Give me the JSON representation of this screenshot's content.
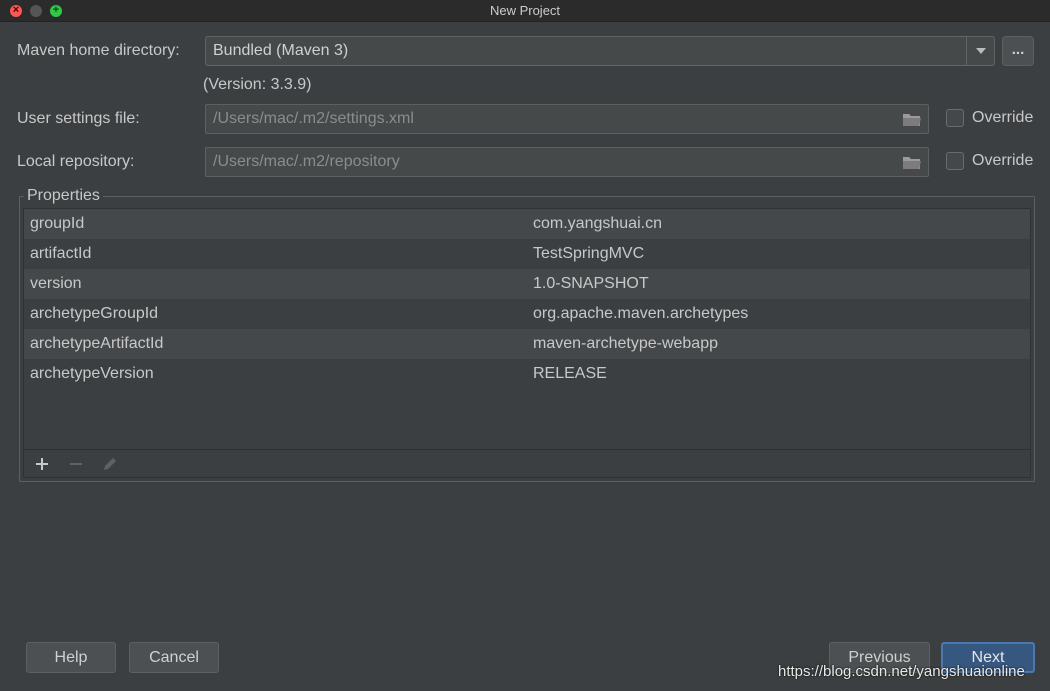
{
  "window": {
    "title": "New Project"
  },
  "maven_home": {
    "label": "Maven home directory:",
    "value": "Bundled (Maven 3)",
    "browse_label": "...",
    "version_text": "(Version: 3.3.9)"
  },
  "user_settings": {
    "label": "User settings file:",
    "value": "/Users/mac/.m2/settings.xml",
    "override_label": "Override"
  },
  "local_repo": {
    "label": "Local repository:",
    "value": "/Users/mac/.m2/repository",
    "override_label": "Override"
  },
  "properties": {
    "title": "Properties",
    "rows": [
      {
        "key": "groupId",
        "value": "com.yangshuai.cn"
      },
      {
        "key": "artifactId",
        "value": "TestSpringMVC"
      },
      {
        "key": "version",
        "value": "1.0-SNAPSHOT"
      },
      {
        "key": "archetypeGroupId",
        "value": "org.apache.maven.archetypes"
      },
      {
        "key": "archetypeArtifactId",
        "value": "maven-archetype-webapp"
      },
      {
        "key": "archetypeVersion",
        "value": "RELEASE"
      }
    ],
    "toolbar": {
      "add_icon": "plus-icon",
      "remove_icon": "minus-icon",
      "edit_icon": "pencil-icon"
    }
  },
  "buttons": {
    "help": "Help",
    "cancel": "Cancel",
    "previous": "Previous",
    "next": "Next"
  },
  "watermark": "https://blog.csdn.net/yangshuaionline",
  "colors": {
    "background": "#3c3f41",
    "primary_button": "#365880",
    "close": "#fc5753",
    "maximize": "#33c748"
  }
}
